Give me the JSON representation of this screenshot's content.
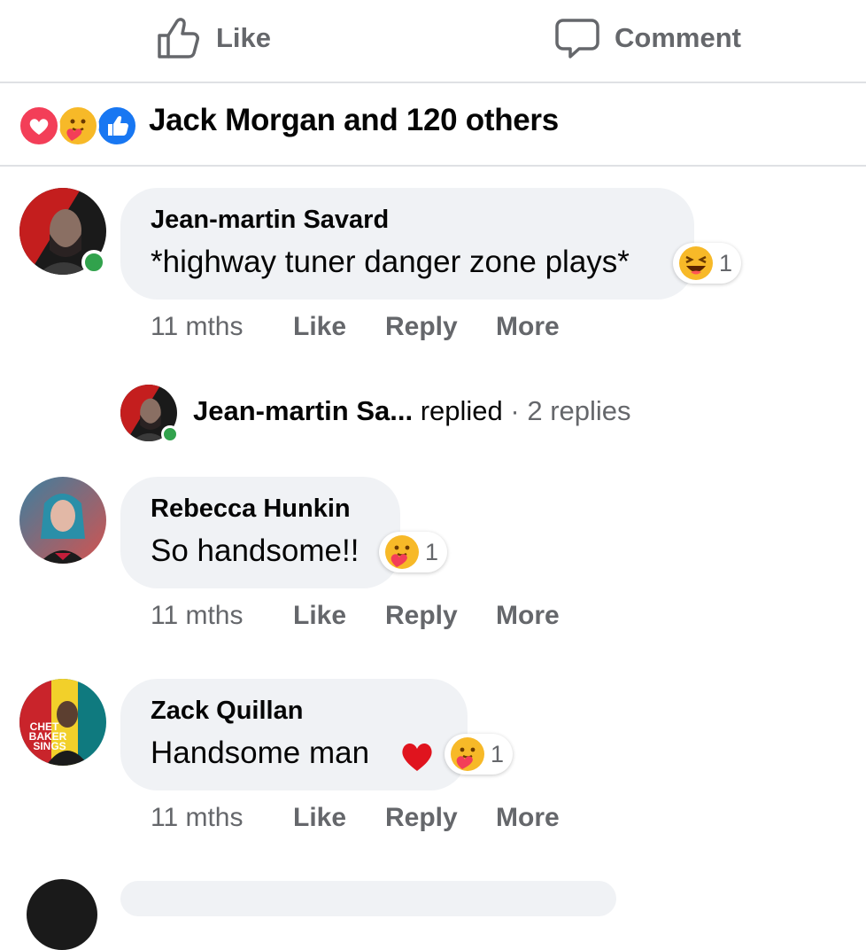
{
  "actions": {
    "like_label": "Like",
    "comment_label": "Comment"
  },
  "reactions_summary": {
    "icons": [
      "love-icon",
      "care-icon",
      "like-icon"
    ],
    "text": "Jack Morgan and 120 others"
  },
  "comments": [
    {
      "author": "Jean-martin Savard",
      "text": "*highway tuner danger zone plays*",
      "reaction_icon": "laughing-emoji-icon",
      "reaction_count": "1",
      "time": "11 mths",
      "like": "Like",
      "reply": "Reply",
      "more": "More",
      "online": true
    },
    {
      "author": "Rebecca Hunkin",
      "text": "So handsome!!",
      "reaction_icon": "care-emoji-icon",
      "reaction_count": "1",
      "time": "11 mths",
      "like": "Like",
      "reply": "Reply",
      "more": "More",
      "online": false
    },
    {
      "author": "Zack Quillan",
      "text": "Handsome man",
      "trailing_emoji": "red-heart-icon",
      "reaction_icon": "care-emoji-icon",
      "reaction_count": "1",
      "time": "11 mths",
      "like": "Like",
      "reply": "Reply",
      "more": "More",
      "online": false,
      "avatar_text": [
        "CHET",
        "BAKER",
        "SINGS"
      ]
    }
  ],
  "reply_summary": {
    "author": "Jean-martin Sa...",
    "verb": "replied",
    "separator": "·",
    "count": "2 replies"
  },
  "colors": {
    "secondary_text": "#65676b",
    "bubble": "#f0f2f5",
    "online": "#31a24c",
    "like_blue": "#1877f2",
    "love_red": "#f33e58"
  }
}
